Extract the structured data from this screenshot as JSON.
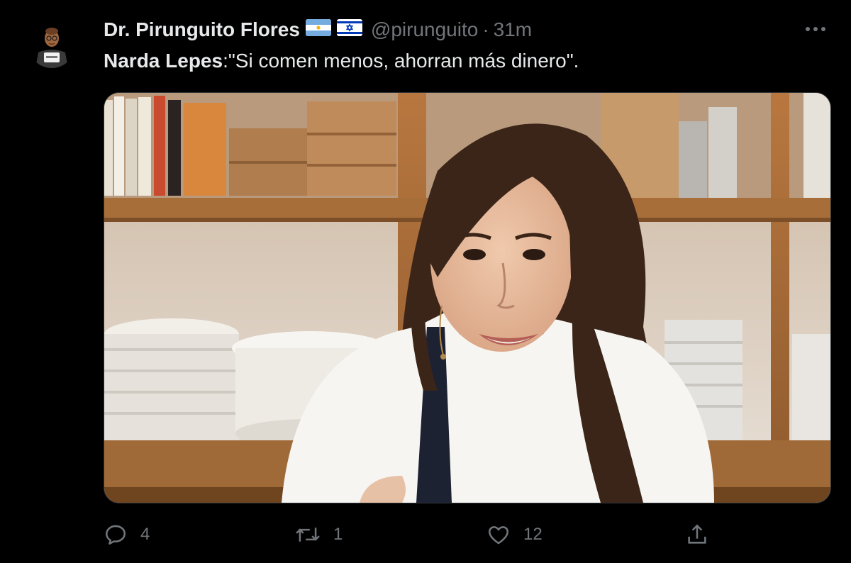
{
  "author": {
    "display_name": "Dr. Pirunguito Flores",
    "handle": "@pirunguito",
    "separator": "·",
    "time": "31m",
    "avatar_icon": "profile-avatar",
    "flags": [
      "argentina-flag",
      "israel-flag"
    ]
  },
  "tweet": {
    "mention_name": "Narda Lepes",
    "quote": ":\"Si comen menos, ahorran más dinero\"."
  },
  "media": {
    "type": "photo",
    "subject": "woman-in-kitchen"
  },
  "actions": {
    "reply_count": "4",
    "retweet_count": "1",
    "like_count": "12",
    "reply_icon": "reply-icon",
    "retweet_icon": "retweet-icon",
    "like_icon": "heart-icon",
    "share_icon": "share-icon",
    "more_icon": "more-icon"
  },
  "colors": {
    "background": "#000000",
    "primary_text": "#e7e9ea",
    "secondary_text": "#71767b",
    "border": "#2f3336"
  }
}
